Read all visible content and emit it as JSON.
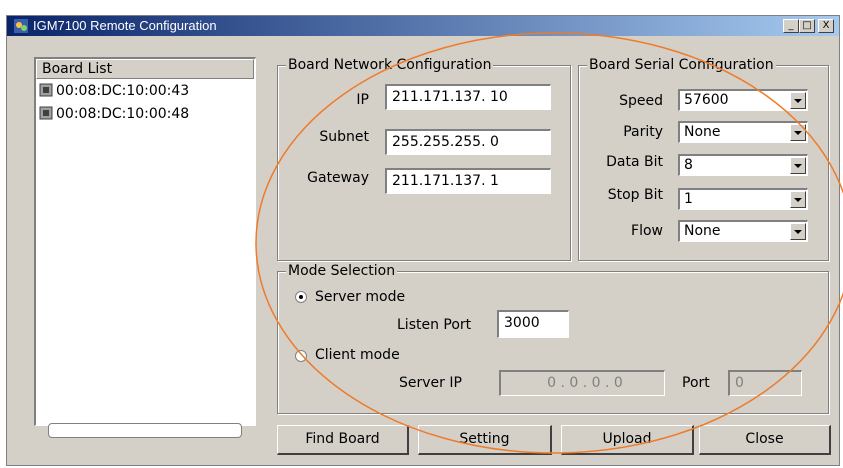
{
  "window": {
    "title": "IGM7100 Remote Configuration",
    "minimize": "_",
    "maximize": "□",
    "close": "X"
  },
  "board_list": {
    "header": "Board List",
    "items": [
      "00:08:DC:10:00:43",
      "00:08:DC:10:00:48"
    ]
  },
  "network": {
    "title": "Board Network Configuration",
    "ip_label": "IP",
    "ip_value": "211.171.137. 10",
    "subnet_label": "Subnet",
    "subnet_value": "255.255.255. 0",
    "gateway_label": "Gateway",
    "gateway_value": "211.171.137. 1"
  },
  "serial": {
    "title": "Board Serial Configuration",
    "speed_label": "Speed",
    "speed_value": "57600",
    "parity_label": "Parity",
    "parity_value": "None",
    "databit_label": "Data Bit",
    "databit_value": "8",
    "stopbit_label": "Stop Bit",
    "stopbit_value": "1",
    "flow_label": "Flow",
    "flow_value": "None"
  },
  "mode": {
    "title": "Mode Selection",
    "server_mode_label": "Server mode",
    "listen_port_label": "Listen Port",
    "listen_port_value": "3000",
    "client_mode_label": "Client mode",
    "server_ip_label": "Server IP",
    "server_ip_value": "0 . 0 . 0 . 0",
    "port_label": "Port",
    "port_value": "0",
    "selected": "server"
  },
  "buttons": {
    "find": "Find Board",
    "setting": "Setting",
    "upload": "Upload",
    "close": "Close"
  },
  "colors": {
    "window_bg": "#d4d0c8",
    "titlebar_start": "#0a246a",
    "titlebar_end": "#a6caf0",
    "annotation": "#ee7b2a"
  }
}
